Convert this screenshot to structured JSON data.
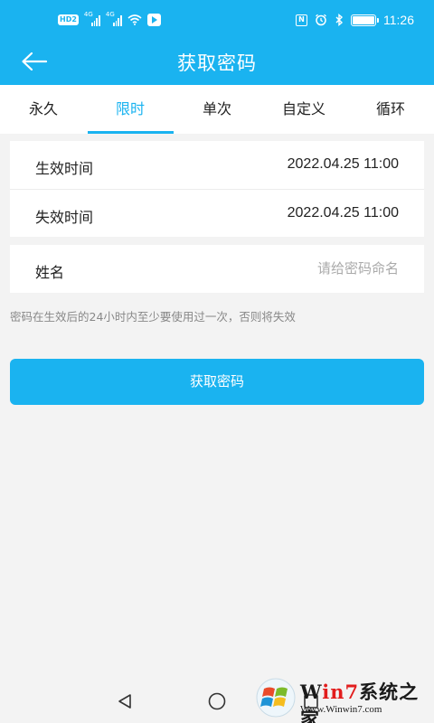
{
  "status_bar": {
    "left_badge": "HD",
    "left_badge_num": "2",
    "signal_tag_1": "4G",
    "signal_tag_2": "4G",
    "time": "11:26",
    "nfc": "N",
    "alarm_icon": "alarm-icon",
    "bluetooth_icon": "bluetooth-icon",
    "battery_level": 1.0
  },
  "app_bar": {
    "title": "获取密码",
    "back_icon": "arrow-left-icon"
  },
  "tabs": [
    {
      "label": "永久",
      "active": false
    },
    {
      "label": "限时",
      "active": true
    },
    {
      "label": "单次",
      "active": false
    },
    {
      "label": "自定义",
      "active": false
    },
    {
      "label": "循环",
      "active": false
    }
  ],
  "time_card": {
    "start_label": "生效时间",
    "start_value": "2022.04.25 11:00",
    "end_label": "失效时间",
    "end_value": "2022.04.25 11:00"
  },
  "name_card": {
    "label": "姓名",
    "value": "",
    "placeholder": "请给密码命名"
  },
  "hint": "密码在生效后的24小时内至少要使用过一次，否则将失效",
  "submit_label": "获取密码",
  "nav": {
    "back_icon": "triangle-back-icon",
    "home_icon": "circle-home-icon",
    "recent_icon": "square-recent-icon"
  },
  "watermark": {
    "title_prefix": "W",
    "title_mid": "in7",
    "title_suffix": "系统之家",
    "url": "Www.Winwin7.com"
  },
  "colors": {
    "accent": "#1ab3f0",
    "background": "#f3f3f3",
    "card": "#ffffff",
    "text": "#222222",
    "hint": "#888888",
    "placeholder": "#aaaaaa"
  }
}
